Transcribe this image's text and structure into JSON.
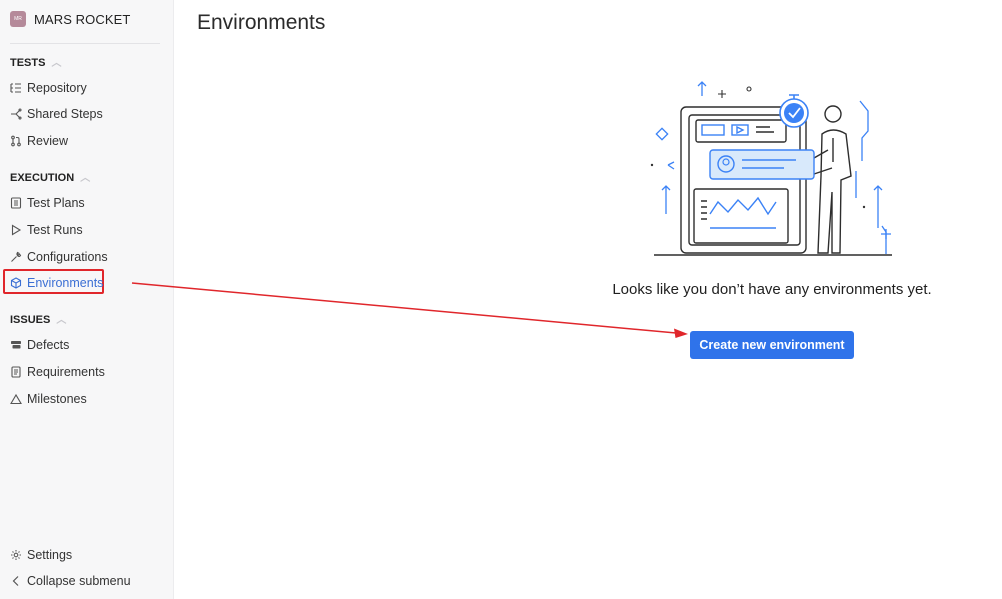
{
  "project": {
    "name": "MARS ROCKET",
    "avatar_text": "MR"
  },
  "sidebar": {
    "sections": [
      {
        "title": "TESTS",
        "items": [
          "Repository",
          "Shared Steps",
          "Review"
        ]
      },
      {
        "title": "EXECUTION",
        "items": [
          "Test Plans",
          "Test Runs",
          "Configurations",
          "Environments"
        ]
      },
      {
        "title": "ISSUES",
        "items": [
          "Defects",
          "Requirements",
          "Milestones"
        ]
      }
    ],
    "active_item": "Environments",
    "bottom": {
      "settings": "Settings",
      "collapse": "Collapse submenu"
    }
  },
  "main": {
    "title": "Environments",
    "empty_message": "Looks like you don’t have any environments yet.",
    "create_button": "Create new environment"
  },
  "colors": {
    "accent": "#2f73ea",
    "annotation": "#e0262b",
    "active_nav": "#3b6fd4"
  }
}
